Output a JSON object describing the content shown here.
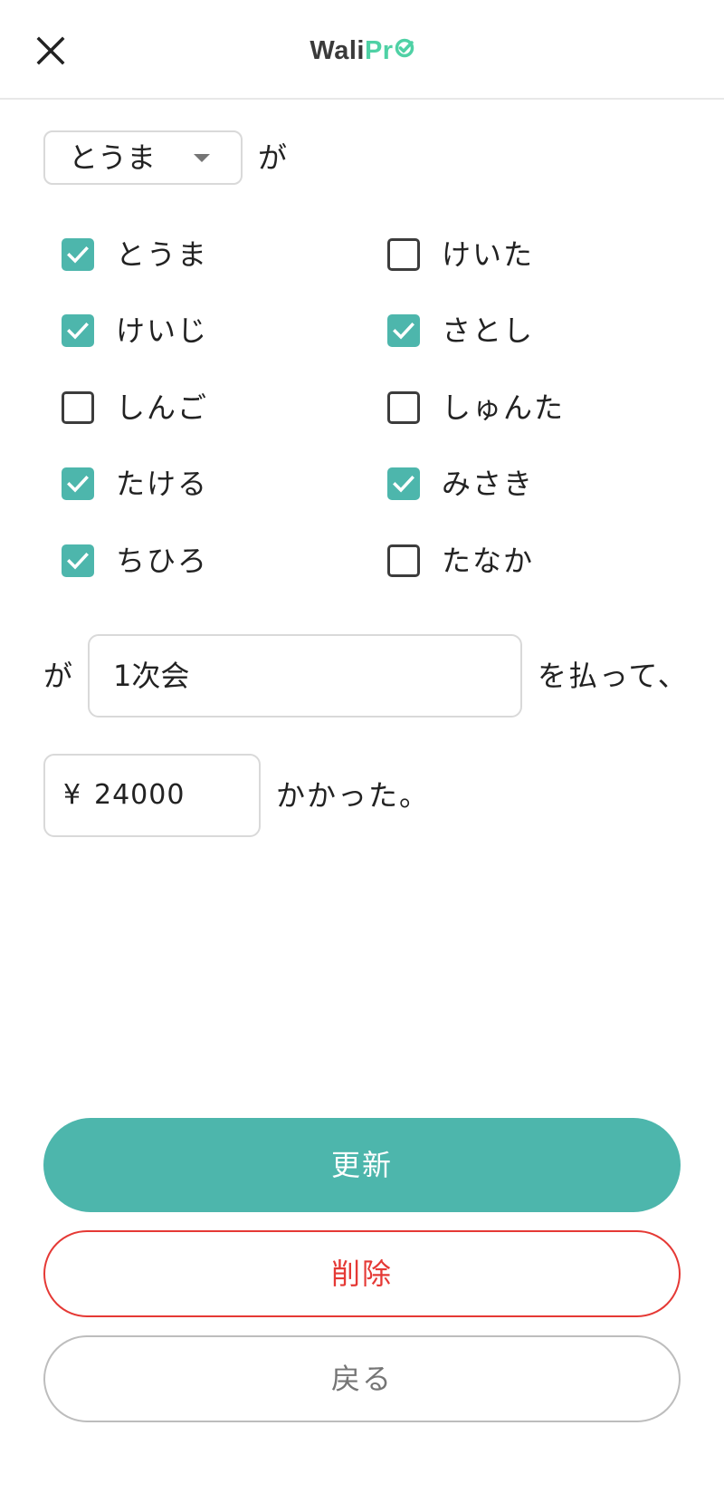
{
  "header": {
    "logo_part1": "Wali",
    "logo_part2": "Pr",
    "close_icon": "close-icon",
    "logo_check_icon": "check-circle-icon",
    "accent_color": "#4fd1a5"
  },
  "form": {
    "payer": {
      "selected": "とうま",
      "suffix": "が"
    },
    "members": [
      {
        "name": "とうま",
        "checked": true
      },
      {
        "name": "けいた",
        "checked": false
      },
      {
        "name": "けいじ",
        "checked": true
      },
      {
        "name": "さとし",
        "checked": true
      },
      {
        "name": "しんご",
        "checked": false
      },
      {
        "name": "しゅんた",
        "checked": false
      },
      {
        "name": "たける",
        "checked": true
      },
      {
        "name": "みさき",
        "checked": true
      },
      {
        "name": "ちひろ",
        "checked": true
      },
      {
        "name": "たなか",
        "checked": false
      }
    ],
    "purpose": {
      "prefix": "が",
      "value": "1次会",
      "suffix": "を払って、"
    },
    "amount": {
      "currency": "¥",
      "value": "24000",
      "suffix": "かかった。"
    }
  },
  "buttons": {
    "update": "更新",
    "delete": "削除",
    "back": "戻る"
  },
  "colors": {
    "primary": "#4db6ac",
    "danger": "#e53935",
    "neutral": "#bdbdbd"
  }
}
